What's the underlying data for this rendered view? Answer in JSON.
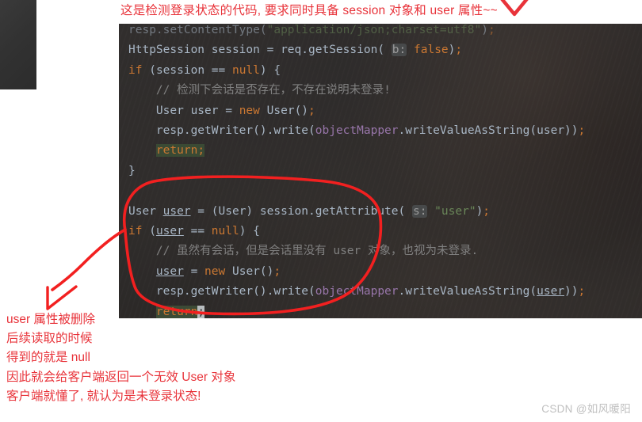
{
  "annotations": {
    "headline": "这是检测登录状态的代码, 要求同时具备 session 对象和 user 属性~~",
    "tick_icon": "red-check-tick",
    "circle_icon": "red-ellipse-highlight",
    "arrow_icon": "red-curved-arrow",
    "note_lines": [
      "user 属性被删除",
      "后续读取的时候",
      "得到的就是 null",
      "因此就会给客户端返回一个无效 User 对象",
      "客户端就懂了, 就认为是未登录状态!"
    ]
  },
  "colors": {
    "ink_red": "#e8333a",
    "editor_bg": "#2f2d2c",
    "default_text": "#a9b7c6",
    "keyword": "#cc7832",
    "string": "#6a8759",
    "field": "#9876aa",
    "comment": "#808080",
    "hint_bg": "#47494a",
    "selection_green": "#3a4a34"
  },
  "code": {
    "language": "java",
    "lines": [
      "resp.setContentType(\"application/json;charset=utf8\");",
      "HttpSession session = req.getSession( b: false);",
      "if (session == null) {",
      "    // 检测下会话是否存在，不存在说明未登录!",
      "    User user = new User();",
      "    resp.getWriter().write(objectMapper.writeValueAsString(user));",
      "    return;",
      "}",
      "",
      "User user = (User) session.getAttribute( s: \"user\");",
      "if (user == null) {",
      "    // 虽然有会话，但是会话里没有 user 对象，也视为未登录.",
      "    user = new User();",
      "    resp.getWriter().write(objectMapper.writeValueAsString(user));",
      "    return;",
      "}"
    ],
    "inlay_hints": [
      "b:",
      "s:"
    ],
    "selected_tokens": [
      "return;",
      "return;"
    ]
  },
  "watermark": "CSDN @如风暖阳"
}
